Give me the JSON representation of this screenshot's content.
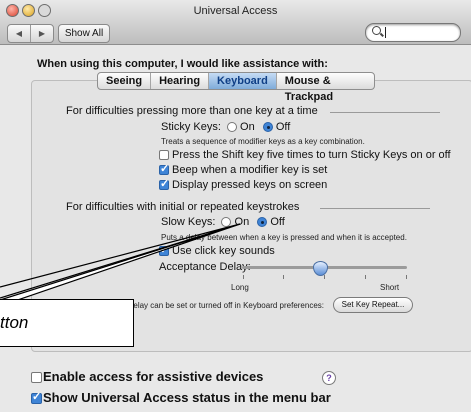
{
  "window": {
    "title": "Universal Access"
  },
  "toolbar": {
    "back_glyph": "◀",
    "forward_glyph": "▶",
    "show_all_label": "Show All",
    "search_value": ""
  },
  "intro_text": "When using this computer, I would like assistance with:",
  "tabs": [
    "Seeing",
    "Hearing",
    "Keyboard",
    "Mouse & Trackpad"
  ],
  "active_tab": "Keyboard",
  "sticky": {
    "heading": "For difficulties pressing more than one key at a time",
    "label": "Sticky Keys:",
    "on_label": "On",
    "off_label": "Off",
    "state": "Off",
    "description": "Treats a sequence of modifier keys as a key combination.",
    "options": [
      {
        "label": "Press the Shift key five times to turn Sticky Keys on or off",
        "checked": false
      },
      {
        "label": "Beep when a modifier key is set",
        "checked": true
      },
      {
        "label": "Display pressed keys on screen",
        "checked": true
      }
    ]
  },
  "slow": {
    "heading": "For difficulties with initial or repeated keystrokes",
    "label": "Slow Keys:",
    "on_label": "On",
    "off_label": "Off",
    "state": "Off",
    "description": "Puts a delay between when a key is pressed and when it is accepted.",
    "click_sounds_label": "Use click key sounds",
    "click_sounds_checked": true,
    "acceptance_delay_label": "Acceptance Delay:",
    "slider_min_label": "Long",
    "slider_max_label": "Short",
    "slider_value_fraction": 0.47
  },
  "key_repeat": {
    "note": "Key repeat delay can be set or turned off in Keyboard preferences:",
    "button_label": "Set Key Repeat..."
  },
  "help_glyph": "?",
  "bottom": {
    "assistive_label": "Enable access for assistive devices",
    "assistive_checked": false,
    "status_label": "Show Universal Access status in the menu bar",
    "status_checked": true
  },
  "callout": {
    "text": "tton"
  },
  "colors": {
    "accent": "#3f84d6",
    "tab_active_text": "#0f3f86",
    "help_purple": "#6b42a8"
  }
}
